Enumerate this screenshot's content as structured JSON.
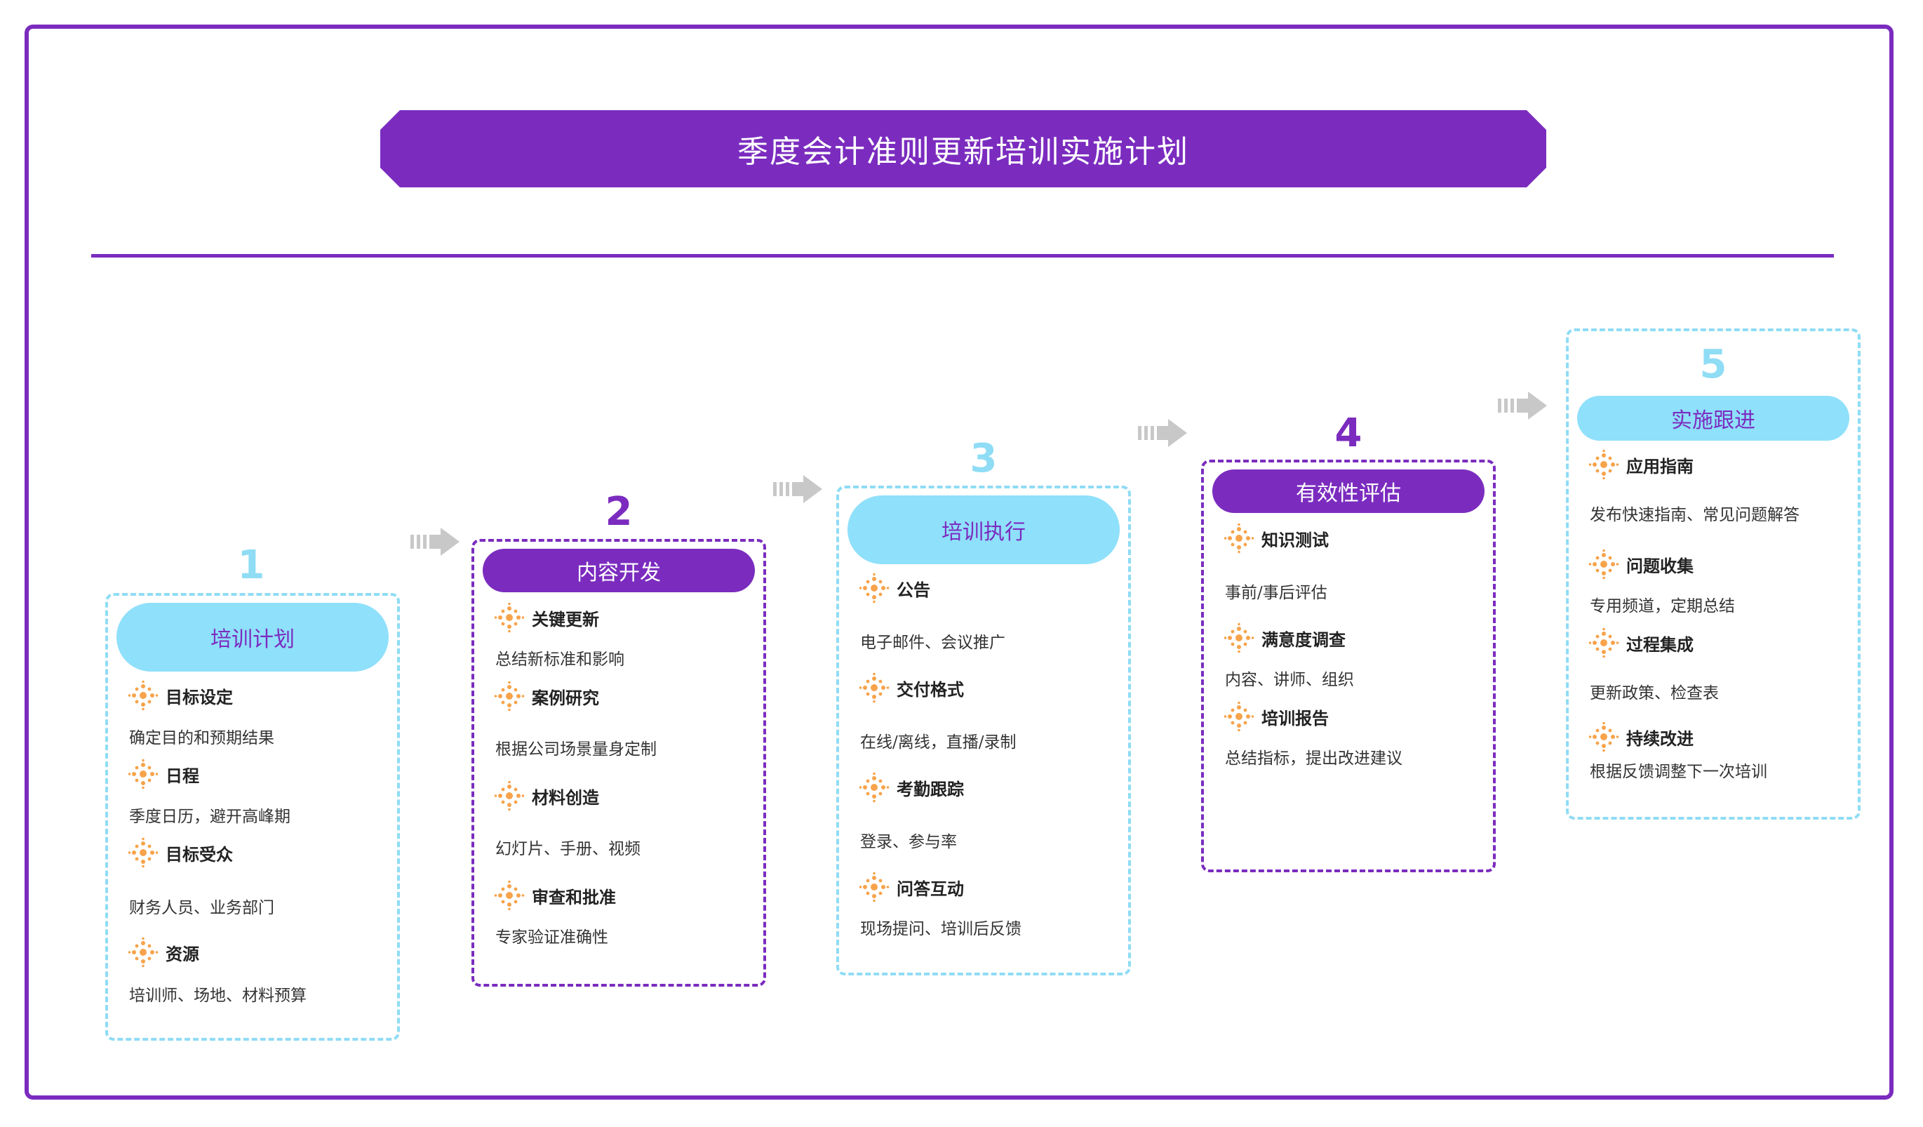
{
  "title": "季度会计准则更新培训实施计划",
  "colors": {
    "accent": "#7b2cbf",
    "light": "#8fe0fb",
    "icon": "#f7a34b",
    "arrow": "#c8c8c8"
  },
  "steps": [
    {
      "number": "1",
      "title": "培训计划",
      "items": [
        {
          "name": "目标设定",
          "desc": "确定目的和预期结果"
        },
        {
          "name": "日程",
          "desc": "季度日历，避开高峰期"
        },
        {
          "name": "目标受众",
          "desc": "财务人员、业务部门"
        },
        {
          "name": "资源",
          "desc": "培训师、场地、材料预算"
        }
      ]
    },
    {
      "number": "2",
      "title": "内容开发",
      "items": [
        {
          "name": "关键更新",
          "desc": "总结新标准和影响"
        },
        {
          "name": "案例研究",
          "desc": "根据公司场景量身定制"
        },
        {
          "name": "材料创造",
          "desc": "幻灯片、手册、视频"
        },
        {
          "name": "审查和批准",
          "desc": "专家验证准确性"
        }
      ]
    },
    {
      "number": "3",
      "title": "培训执行",
      "items": [
        {
          "name": "公告",
          "desc": "电子邮件、会议推广"
        },
        {
          "name": "交付格式",
          "desc": "在线/离线，直播/录制"
        },
        {
          "name": "考勤跟踪",
          "desc": "登录、参与率"
        },
        {
          "name": "问答互动",
          "desc": "现场提问、培训后反馈"
        }
      ]
    },
    {
      "number": "4",
      "title": "有效性评估",
      "items": [
        {
          "name": "知识测试",
          "desc": "事前/事后评估"
        },
        {
          "name": "满意度调查",
          "desc": "内容、讲师、组织"
        },
        {
          "name": "培训报告",
          "desc": "总结指标，提出改进建议"
        }
      ]
    },
    {
      "number": "5",
      "title": "实施跟进",
      "items": [
        {
          "name": "应用指南",
          "desc": "发布快速指南、常见问题解答"
        },
        {
          "name": "问题收集",
          "desc": "专用频道，定期总结"
        },
        {
          "name": "过程集成",
          "desc": "更新政策、检查表"
        },
        {
          "name": "持续改进",
          "desc": "根据反馈调整下一次培训"
        }
      ]
    }
  ]
}
